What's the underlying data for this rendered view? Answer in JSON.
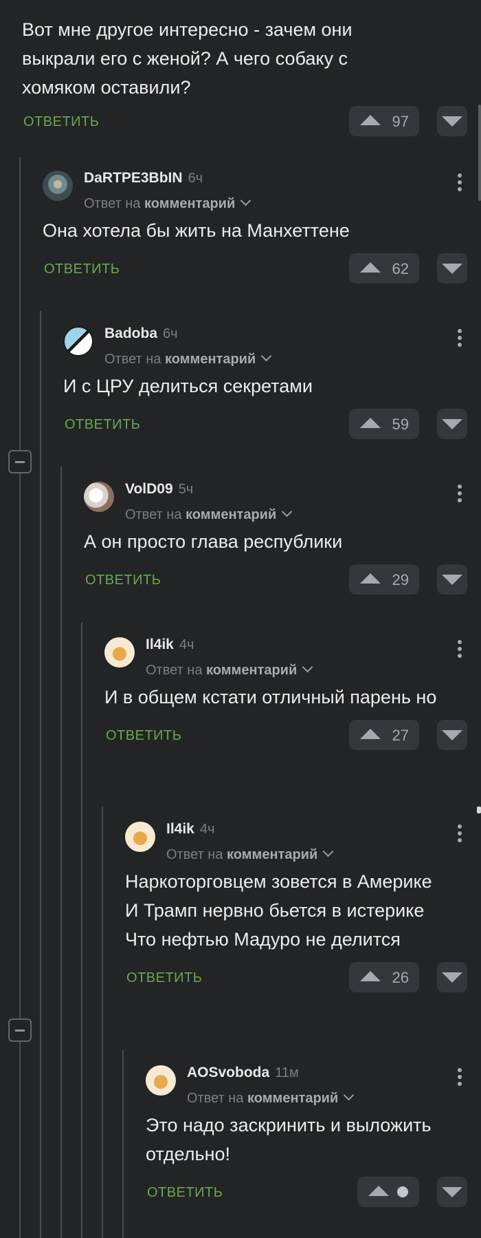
{
  "root": {
    "text": "Вот мне другое интересно - зачем они выкрали его с женой? А чего собаку с хомяком оставили?",
    "reply_label": "ОТВЕТИТЬ",
    "rating": "97"
  },
  "comments": [
    {
      "nick": "DaRTPE3BbIN",
      "time": "6ч",
      "reply_prefix": "Ответ на",
      "reply_target": "комментарий",
      "text": "Она хотела бы жить на Манхеттене",
      "reply_label": "ОТВЕТИТЬ",
      "rating": "62"
    },
    {
      "nick": "Badoba",
      "time": "6ч",
      "reply_prefix": "Ответ на",
      "reply_target": "комментарий",
      "text": "И с ЦРУ делиться секретами",
      "reply_label": "ОТВЕТИТЬ",
      "rating": "59"
    },
    {
      "nick": "VolD09",
      "time": "5ч",
      "reply_prefix": "Ответ на",
      "reply_target": "комментарий",
      "text": "А он просто глава республики",
      "reply_label": "ОТВЕТИТЬ",
      "rating": "29"
    },
    {
      "nick": "Il4ik",
      "time": "4ч",
      "reply_prefix": "Ответ на",
      "reply_target": "комментарий",
      "text": "И в общем кстати отличный парень но",
      "reply_label": "ОТВЕТИТЬ",
      "rating": "27"
    },
    {
      "nick": "Il4ik",
      "time": "4ч",
      "reply_prefix": "Ответ на",
      "reply_target": "комментарий",
      "text_lines": [
        "Наркоторговцем зовется в Америке",
        "И Трамп нервно бьется в истерике",
        "Что нефтью Мадуро не делится"
      ],
      "reply_label": "ОТВЕТИТЬ",
      "rating": "26"
    },
    {
      "nick": "AOSvoboda",
      "time": "11м",
      "reply_prefix": "Ответ на",
      "reply_target": "комментарий",
      "text": "Это надо заскринить и выложить отдельно!",
      "reply_label": "ОТВЕТИТЬ",
      "rating": ""
    }
  ],
  "icons": {
    "upvote": "upvote-triangle-icon",
    "downvote": "downvote-triangle-icon",
    "more": "kebab-menu-icon",
    "collapse": "collapse-minus-icon",
    "reply_dropdown": "chevron-down-icon"
  },
  "colors": {
    "background": "#222426",
    "accent_green": "#6aa84f",
    "button_bg": "#35383b"
  }
}
